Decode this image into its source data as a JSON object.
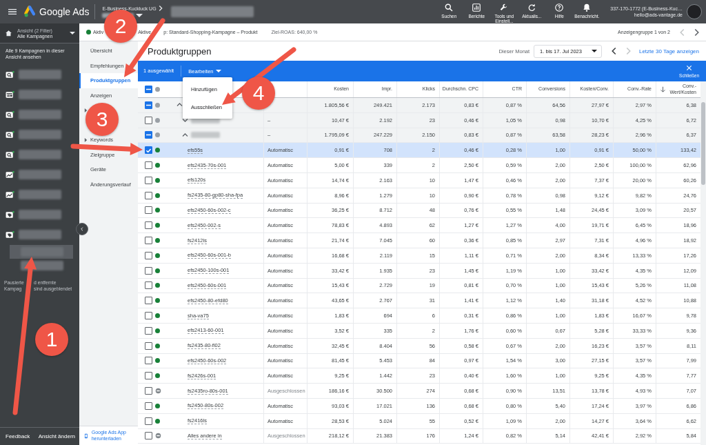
{
  "topbar": {
    "product": "Google Ads",
    "account": "E-Business-Kuckluck UG",
    "actions": [
      {
        "kind": "search",
        "label": "Suchen"
      },
      {
        "kind": "reports",
        "label": "Berichte"
      },
      {
        "kind": "tools",
        "label": "Tools und Einstell..."
      },
      {
        "kind": "refresh",
        "label": "Aktualis..."
      },
      {
        "kind": "help",
        "label": "Hilfe"
      },
      {
        "kind": "notifications",
        "label": "Benachricht."
      }
    ],
    "user": {
      "account_line": "337-170-1772 (E-Business-Kuc…",
      "email": "hello@ads-vantage.de"
    }
  },
  "view_panel": {
    "filter": "Ansicht (2 Filter)",
    "view": "Alle Kampagnen",
    "link": "Alle 9 Kampagnen in dieser Ansicht ansehen",
    "campaigns": [
      {
        "kind": "search",
        "selected": false
      },
      {
        "kind": "display",
        "selected": false
      },
      {
        "kind": "search",
        "selected": false
      },
      {
        "kind": "search",
        "selected": false
      },
      {
        "kind": "search",
        "selected": false
      },
      {
        "kind": "performance",
        "selected": false
      },
      {
        "kind": "performance",
        "selected": false
      },
      {
        "kind": "shopping",
        "selected": false
      },
      {
        "kind": "shopping",
        "selected": false
      },
      {
        "kind": "adgroup",
        "selected": true
      },
      {
        "kind": "adgroup",
        "selected": false
      }
    ],
    "note_lines": [
      [
        "Pausierte",
        "d entfernte"
      ],
      [
        "Kampag",
        "sind ausgeblendet"
      ]
    ],
    "footer": [
      "Feedback",
      "Ansicht ändern"
    ]
  },
  "status_bar": {
    "active": true,
    "status": "Aktiv",
    "ad_group": [
      "Aktive",
      "p: Standard-Shopping-Kampagne – Produkt"
    ],
    "target_roas": "Ziel-ROAS: 640,00 %",
    "pager": "Anzeigengruppe 1 von 2",
    "prev_disabled": true,
    "next_disabled": false
  },
  "nav": {
    "items": [
      {
        "label": "Übersicht",
        "selected": false,
        "expandable": false
      },
      {
        "label": "Empfehlungen",
        "selected": false,
        "expandable": false
      },
      {
        "label": "Produktgruppen",
        "selected": true,
        "expandable": false
      },
      {
        "label": "Anzeigen",
        "selected": false,
        "expandable": false
      },
      {
        "expandable": true
      },
      {
        "label": "Keywords",
        "selected": false,
        "expandable": true
      },
      {
        "label": "Zielgruppe",
        "selected": false,
        "expandable": false
      },
      {
        "label": "Geräte",
        "selected": false,
        "expandable": false
      },
      {
        "label": "Änderungsverlauf",
        "selected": false,
        "expandable": false
      }
    ],
    "app_link": "Google Ads App herunterladen"
  },
  "page": {
    "title": "Produktgruppen",
    "period_label": "Dieser Monat",
    "date_range": "1. bis 17. Jul 2023",
    "prev_disabled": false,
    "next_disabled": true,
    "last_30": "Letzte 30 Tage anzeigen"
  },
  "selection_bar": {
    "count": "1 ausgewählt",
    "edit": "Bearbeiten",
    "close": "Schließen"
  },
  "edit_menu": {
    "items": [
      "Hinzufügen",
      "Ausschließen"
    ]
  },
  "table": {
    "header_checked": true,
    "header_indeterminate": true,
    "columns": [
      {
        "label": "Kosten",
        "sorted_descending": false
      },
      {
        "label": "Impr.",
        "sorted_descending": false
      },
      {
        "label": "Klicks",
        "sorted_descending": false
      },
      {
        "label": "Durchschn. CPC",
        "sorted_descending": false
      },
      {
        "label": "CTR",
        "sorted_descending": false
      },
      {
        "label": "Conversions",
        "sorted_descending": false
      },
      {
        "label": "Kosten/Conv.",
        "sorted_descending": false
      },
      {
        "label": "Conv.-Rate",
        "sorted_descending": false
      },
      {
        "label": "Conv.-Wert/Kosten",
        "sorted_descending": true
      }
    ],
    "rows": [
      {
        "kind": "group",
        "checked": true,
        "indeterminate": true,
        "selected": false,
        "expanded": true,
        "values": [
          "1.805,56 €",
          "249.421",
          "2.173",
          "0,83 €",
          "0,87 %",
          "64,56",
          "27,97 €",
          "2,97 %",
          "6,38"
        ],
        "children": [
          {
            "kind": "group",
            "checked": false,
            "indeterminate": false,
            "selected": false,
            "expanded": false,
            "blurred_name": true,
            "bid": "–",
            "values": [
              "10,47 €",
              "2.192",
              "23",
              "0,46 €",
              "1,05 %",
              "0,98",
              "10,70 €",
              "4,25 %",
              "6,72"
            ]
          },
          {
            "kind": "group",
            "checked": true,
            "indeterminate": true,
            "selected": false,
            "expanded": true,
            "blurred_name": true,
            "bid": "–",
            "values": [
              "1.795,09 €",
              "247.229",
              "2.150",
              "0,83 €",
              "0,87 %",
              "63,58",
              "28,23 €",
              "2,96 %",
              "6,37"
            ],
            "children": [
              {
                "kind": "active",
                "checked": true,
                "indeterminate": false,
                "selected": true,
                "name": "efs55s",
                "bid": "Automatisc",
                "values": [
                  "0,91 €",
                  "708",
                  "2",
                  "0,46 €",
                  "0,28 %",
                  "1,00",
                  "0,91 €",
                  "50,00 %",
                  "133,42"
                ]
              },
              {
                "kind": "active",
                "checked": false,
                "indeterminate": false,
                "selected": false,
                "name": "efs2435-70s-001",
                "bid": "Automatisc",
                "values": [
                  "5,00 €",
                  "339",
                  "2",
                  "2,50 €",
                  "0,59 %",
                  "2,00",
                  "2,50 €",
                  "100,00 %",
                  "62,96"
                ]
              },
              {
                "kind": "active",
                "checked": false,
                "indeterminate": false,
                "selected": false,
                "name": "efs120s",
                "bid": "Automatisc",
                "values": [
                  "14,74 €",
                  "2.163",
                  "10",
                  "1,47 €",
                  "0,46 %",
                  "2,00",
                  "7,37 €",
                  "20,00 %",
                  "60,26"
                ]
              },
              {
                "kind": "active",
                "checked": false,
                "indeterminate": false,
                "selected": false,
                "name": "fs2435-80-gp80-sha-fpa",
                "bid": "Automatisc",
                "values": [
                  "8,96 €",
                  "1.279",
                  "10",
                  "0,90 €",
                  "0,78 %",
                  "0,98",
                  "9,12 €",
                  "9,82 %",
                  "24,76"
                ]
              },
              {
                "kind": "active",
                "checked": false,
                "indeterminate": false,
                "selected": false,
                "name": "efs2450-60s-002-c",
                "bid": "Automatisc",
                "values": [
                  "36,25 €",
                  "8.712",
                  "48",
                  "0,76 €",
                  "0,55 %",
                  "1,48",
                  "24,45 €",
                  "3,09 %",
                  "20,57"
                ]
              },
              {
                "kind": "active",
                "checked": false,
                "indeterminate": false,
                "selected": false,
                "name": "efs2450-002-s",
                "bid": "Automatisc",
                "values": [
                  "78,83 €",
                  "4.893",
                  "62",
                  "1,27 €",
                  "1,27 %",
                  "4,00",
                  "19,71 €",
                  "6,45 %",
                  "18,96"
                ]
              },
              {
                "kind": "active",
                "checked": false,
                "indeterminate": false,
                "selected": false,
                "name": "fs2412ls",
                "bid": "Automatisc",
                "values": [
                  "21,74 €",
                  "7.045",
                  "60",
                  "0,36 €",
                  "0,85 %",
                  "2,97",
                  "7,31 €",
                  "4,96 %",
                  "18,92"
                ]
              },
              {
                "kind": "active",
                "checked": false,
                "indeterminate": false,
                "selected": false,
                "name": "efs2450-60s-001-b",
                "bid": "Automatisc",
                "values": [
                  "16,68 €",
                  "2.119",
                  "15",
                  "1,11 €",
                  "0,71 %",
                  "2,00",
                  "8,34 €",
                  "13,33 %",
                  "17,26"
                ]
              },
              {
                "kind": "active",
                "checked": false,
                "indeterminate": false,
                "selected": false,
                "name": "efs2450-100s-001",
                "bid": "Automatisc",
                "values": [
                  "33,42 €",
                  "1.935",
                  "23",
                  "1,45 €",
                  "1,19 %",
                  "1,00",
                  "33,42 €",
                  "4,35 %",
                  "12,09"
                ]
              },
              {
                "kind": "active",
                "checked": false,
                "indeterminate": false,
                "selected": false,
                "name": "efs2450-60s-001",
                "bid": "Automatisc",
                "values": [
                  "15,43 €",
                  "2.729",
                  "19",
                  "0,81 €",
                  "0,70 %",
                  "1,00",
                  "15,43 €",
                  "5,26 %",
                  "11,08"
                ]
              },
              {
                "kind": "active",
                "checked": false,
                "indeterminate": false,
                "selected": false,
                "name": "efs2450-80-efd80",
                "bid": "Automatisc",
                "values": [
                  "43,65 €",
                  "2.767",
                  "31",
                  "1,41 €",
                  "1,12 %",
                  "1,40",
                  "31,18 €",
                  "4,52 %",
                  "10,88"
                ]
              },
              {
                "kind": "active",
                "checked": false,
                "indeterminate": false,
                "selected": false,
                "name": "sha-va75",
                "bid": "Automatisc",
                "values": [
                  "1,83 €",
                  "694",
                  "6",
                  "0,31 €",
                  "0,86 %",
                  "1,00",
                  "1,83 €",
                  "16,67 %",
                  "9,78"
                ]
              },
              {
                "kind": "active",
                "checked": false,
                "indeterminate": false,
                "selected": false,
                "name": "efs2413-60-001",
                "bid": "Automatisc",
                "values": [
                  "3,52 €",
                  "335",
                  "2",
                  "1,76 €",
                  "0,60 %",
                  "0,67",
                  "5,28 €",
                  "33,33 %",
                  "9,36"
                ]
              },
              {
                "kind": "active",
                "checked": false,
                "indeterminate": false,
                "selected": false,
                "name": "fs2435-80-fl02",
                "bid": "Automatisc",
                "values": [
                  "32,45 €",
                  "8.404",
                  "56",
                  "0,58 €",
                  "0,67 %",
                  "2,00",
                  "16,23 €",
                  "3,57 %",
                  "8,11"
                ]
              },
              {
                "kind": "active",
                "checked": false,
                "indeterminate": false,
                "selected": false,
                "name": "efs2450-60s-002",
                "bid": "Automatisc",
                "values": [
                  "81,45 €",
                  "5.453",
                  "84",
                  "0,97 €",
                  "1,54 %",
                  "3,00",
                  "27,15 €",
                  "3,57 %",
                  "7,99"
                ]
              },
              {
                "kind": "active",
                "checked": false,
                "indeterminate": false,
                "selected": false,
                "name": "fs2426s-001",
                "bid": "Automatisc",
                "values": [
                  "9,25 €",
                  "1.442",
                  "23",
                  "0,40 €",
                  "1,60 %",
                  "1,00",
                  "9,25 €",
                  "4,35 %",
                  "7,77"
                ]
              },
              {
                "kind": "excluded",
                "checked": false,
                "indeterminate": false,
                "selected": false,
                "name": "fs2435ro-80s-001",
                "bid": "Ausgeschlossen",
                "values": [
                  "186,16 €",
                  "30.500",
                  "274",
                  "0,68 €",
                  "0,90 %",
                  "13,51",
                  "13,78 €",
                  "4,93 %",
                  "7,07"
                ]
              },
              {
                "kind": "active",
                "checked": false,
                "indeterminate": false,
                "selected": false,
                "name": "fs2450-80s-002",
                "bid": "Automatisc",
                "values": [
                  "93,03 €",
                  "17.021",
                  "136",
                  "0,68 €",
                  "0,80 %",
                  "5,40",
                  "17,24 €",
                  "3,97 %",
                  "6,86"
                ]
              },
              {
                "kind": "active",
                "checked": false,
                "indeterminate": false,
                "selected": false,
                "name": "fs2416ls",
                "bid": "Automatisc",
                "values": [
                  "28,53 €",
                  "5.024",
                  "55",
                  "0,52 €",
                  "1,09 %",
                  "2,00",
                  "14,27 €",
                  "3,64 %",
                  "6,62"
                ]
              },
              {
                "kind": "excluded",
                "checked": false,
                "indeterminate": false,
                "selected": false,
                "name": "Alles andere in",
                "bid": "Ausgeschlossen",
                "values": [
                  "218,12 €",
                  "21.383",
                  "176",
                  "1,24 €",
                  "0,82 %",
                  "5,14",
                  "42,41 €",
                  "2,92 %",
                  "5,84"
                ]
              }
            ]
          }
        ]
      }
    ]
  },
  "annotations": [
    "1",
    "2",
    "3",
    "4"
  ]
}
